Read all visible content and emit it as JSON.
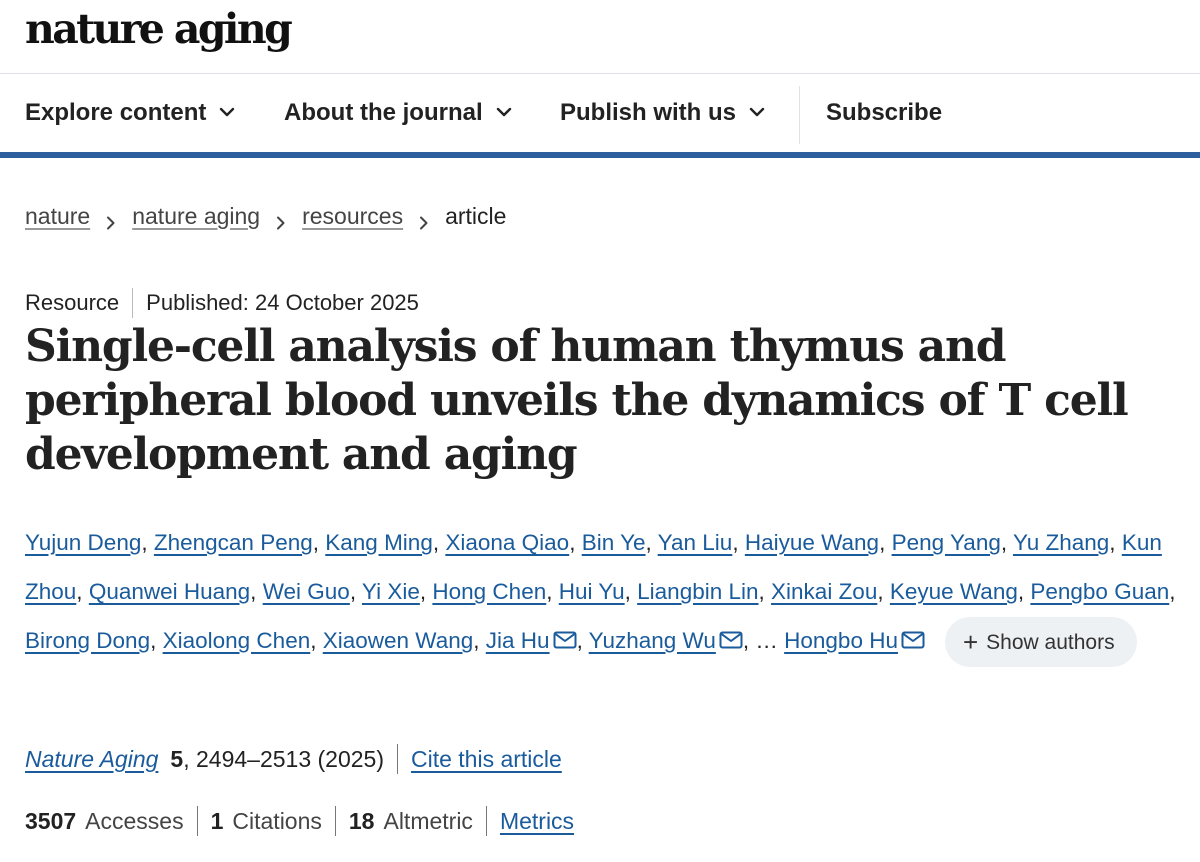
{
  "header": {
    "brand": "nature aging"
  },
  "nav": {
    "items": [
      {
        "label": "Explore content",
        "has_menu": true
      },
      {
        "label": "About the journal",
        "has_menu": true
      },
      {
        "label": "Publish with us",
        "has_menu": true
      },
      {
        "label": "Subscribe",
        "has_menu": false
      }
    ],
    "accent_color": "#2d5f9e"
  },
  "breadcrumb": {
    "items": [
      "nature",
      "nature aging",
      "resources"
    ],
    "current": "article"
  },
  "article": {
    "type": "Resource",
    "published": "Published: 24 October 2025",
    "title": "Single-cell analysis of human thymus and peripheral blood unveils the dynamics of T cell development and aging",
    "authors": [
      {
        "name": "Yujun Deng",
        "email": false
      },
      {
        "name": "Zhengcan Peng",
        "email": false
      },
      {
        "name": "Kang Ming",
        "email": false
      },
      {
        "name": "Xiaona Qiao",
        "email": false
      },
      {
        "name": "Bin Ye",
        "email": false
      },
      {
        "name": "Yan Liu",
        "email": false
      },
      {
        "name": "Haiyue Wang",
        "email": false
      },
      {
        "name": "Peng Yang",
        "email": false
      },
      {
        "name": "Yu Zhang",
        "email": false
      },
      {
        "name": "Kun Zhou",
        "email": false
      },
      {
        "name": "Quanwei Huang",
        "email": false
      },
      {
        "name": "Wei Guo",
        "email": false
      },
      {
        "name": "Yi Xie",
        "email": false
      },
      {
        "name": "Hong Chen",
        "email": false
      },
      {
        "name": "Hui Yu",
        "email": false
      },
      {
        "name": "Liangbin Lin",
        "email": false
      },
      {
        "name": "Xinkai Zou",
        "email": false
      },
      {
        "name": "Keyue Wang",
        "email": false
      },
      {
        "name": "Pengbo Guan",
        "email": false
      },
      {
        "name": "Birong Dong",
        "email": false
      },
      {
        "name": "Xiaolong Chen",
        "email": false
      },
      {
        "name": "Xiaowen Wang",
        "email": false
      },
      {
        "name": "Jia Hu",
        "email": true
      },
      {
        "name": "Yuzhang Wu",
        "email": true
      }
    ],
    "ellipsis": "…",
    "last_author": {
      "name": "Hongbo Hu",
      "email": true
    },
    "show_authors_label": "Show authors",
    "journal": "Nature Aging",
    "volume": "5",
    "pages_year": ", 2494–2513 (2025)",
    "cite_label": "Cite this article",
    "metrics": {
      "accesses_value": "3507",
      "accesses_label": "Accesses",
      "citations_value": "1",
      "citations_label": "Citations",
      "altmetric_value": "18",
      "altmetric_label": "Altmetric",
      "metrics_link": "Metrics"
    },
    "link_color": "#1a5b9c"
  }
}
